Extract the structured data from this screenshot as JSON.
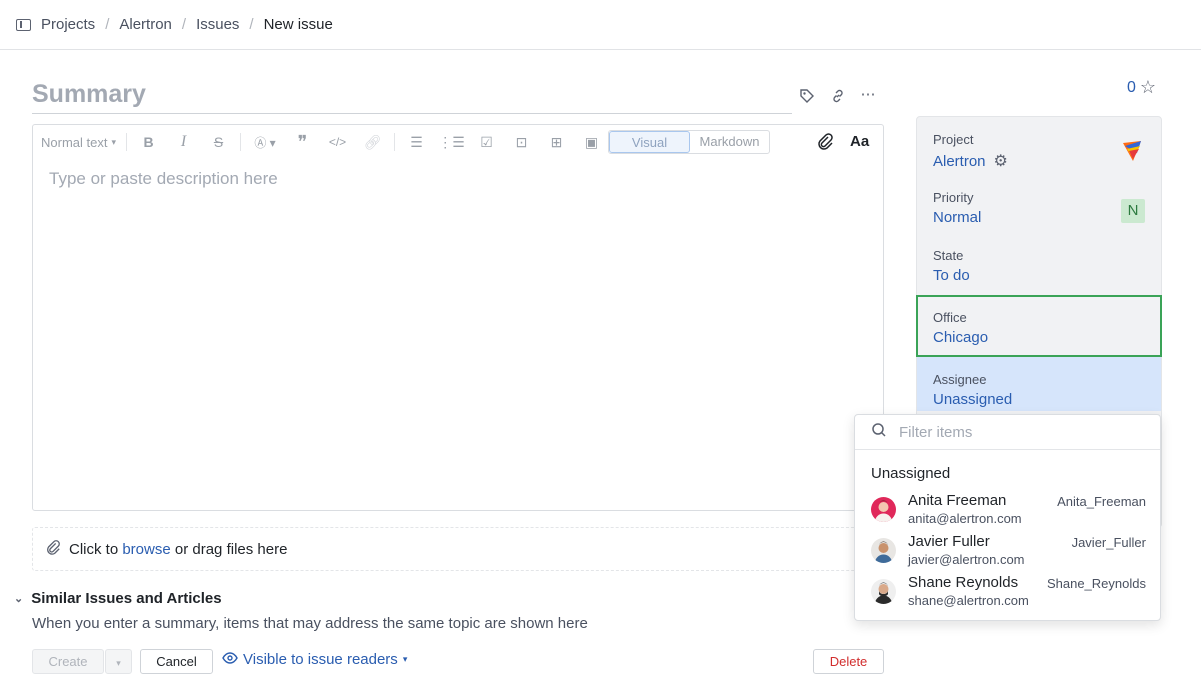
{
  "breadcrumb": {
    "items": [
      "Projects",
      "Alertron",
      "Issues"
    ],
    "current": "New issue"
  },
  "summary": {
    "placeholder": "Summary"
  },
  "editor": {
    "text_style": "Normal text",
    "modes": [
      "Visual",
      "Markdown"
    ],
    "font_button": "Aa",
    "placeholder": "Type or paste description here"
  },
  "attachments": {
    "prefix": "Click to ",
    "link": "browse",
    "suffix": " or drag files here"
  },
  "similar": {
    "title": "Similar Issues and Articles",
    "description": "When you enter a summary, items that may address the same topic are shown here"
  },
  "actions": {
    "create": "Create",
    "cancel": "Cancel",
    "visibility": "Visible to issue readers",
    "delete": "Delete"
  },
  "star": {
    "count": "0"
  },
  "fields": {
    "project": {
      "label": "Project",
      "value": "Alertron"
    },
    "priority": {
      "label": "Priority",
      "value": "Normal",
      "badge": "N",
      "badge_color": "#cbe9d0"
    },
    "state": {
      "label": "State",
      "value": "To do"
    },
    "office": {
      "label": "Office",
      "value": "Chicago"
    },
    "assignee": {
      "label": "Assignee",
      "value": "Unassigned"
    }
  },
  "dropdown": {
    "filter_placeholder": "Filter items",
    "unassigned": "Unassigned",
    "users": [
      {
        "name": "Anita Freeman",
        "email": "anita@alertron.com",
        "login": "Anita_Freeman"
      },
      {
        "name": "Javier Fuller",
        "email": "javier@alertron.com",
        "login": "Javier_Fuller"
      },
      {
        "name": "Shane Reynolds",
        "email": "shane@alertron.com",
        "login": "Shane_Reynolds"
      }
    ]
  },
  "colors": {
    "link": "#2a5db0",
    "office_border": "#3aa357",
    "assignee_highlight": "#d6e5fb",
    "delete": "#d12d2d"
  }
}
